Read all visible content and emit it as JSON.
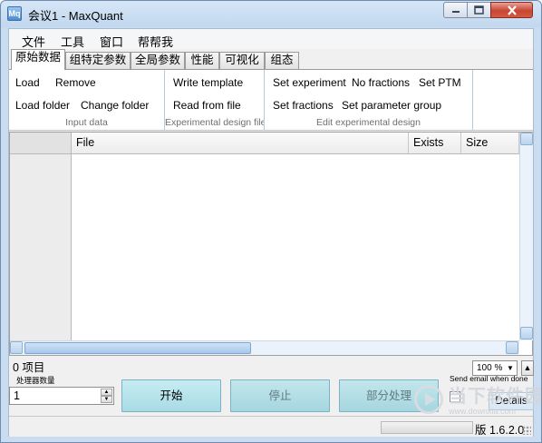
{
  "window": {
    "title": "会议1 - MaxQuant",
    "icon_text": "Mq"
  },
  "menu": [
    "文件",
    "工具",
    "窗口",
    "帮帮我"
  ],
  "tabs": [
    "原始数据",
    "组特定参数",
    "全局参数",
    "性能",
    "可视化",
    "组态"
  ],
  "active_tab": "原始数据",
  "ribbon": {
    "input_data": {
      "label": "Input data",
      "buttons": [
        "Load",
        "Remove",
        "Load folder",
        "Change folder"
      ]
    },
    "experimental_design": {
      "label": "Experimental design file",
      "buttons": [
        "Write template",
        "Read from file"
      ]
    },
    "edit_experimental_design": {
      "label": "Edit experimental design",
      "buttons": [
        "Set experiment",
        "No fractions",
        "Set PTM",
        "Set fractions",
        "Set parameter group"
      ]
    }
  },
  "grid": {
    "columns": [
      "File",
      "Exists",
      "Size"
    ],
    "rows": []
  },
  "status": {
    "item_count": "0 项目",
    "zoom": "100 %",
    "send_email": "Send email when done",
    "threads_label": "处理器数量",
    "threads_value": "1",
    "version": "版 1.6.2.0"
  },
  "actions": {
    "start": "开始",
    "stop": "停止",
    "partial": "部分处理",
    "details": "Details"
  },
  "watermark": {
    "brand": "当下软件园",
    "url": "www.downxia.com"
  },
  "colors": {
    "action_button": "#b4e2ea",
    "close_button": "#c84533",
    "titlebar": "#c2d8ef"
  }
}
